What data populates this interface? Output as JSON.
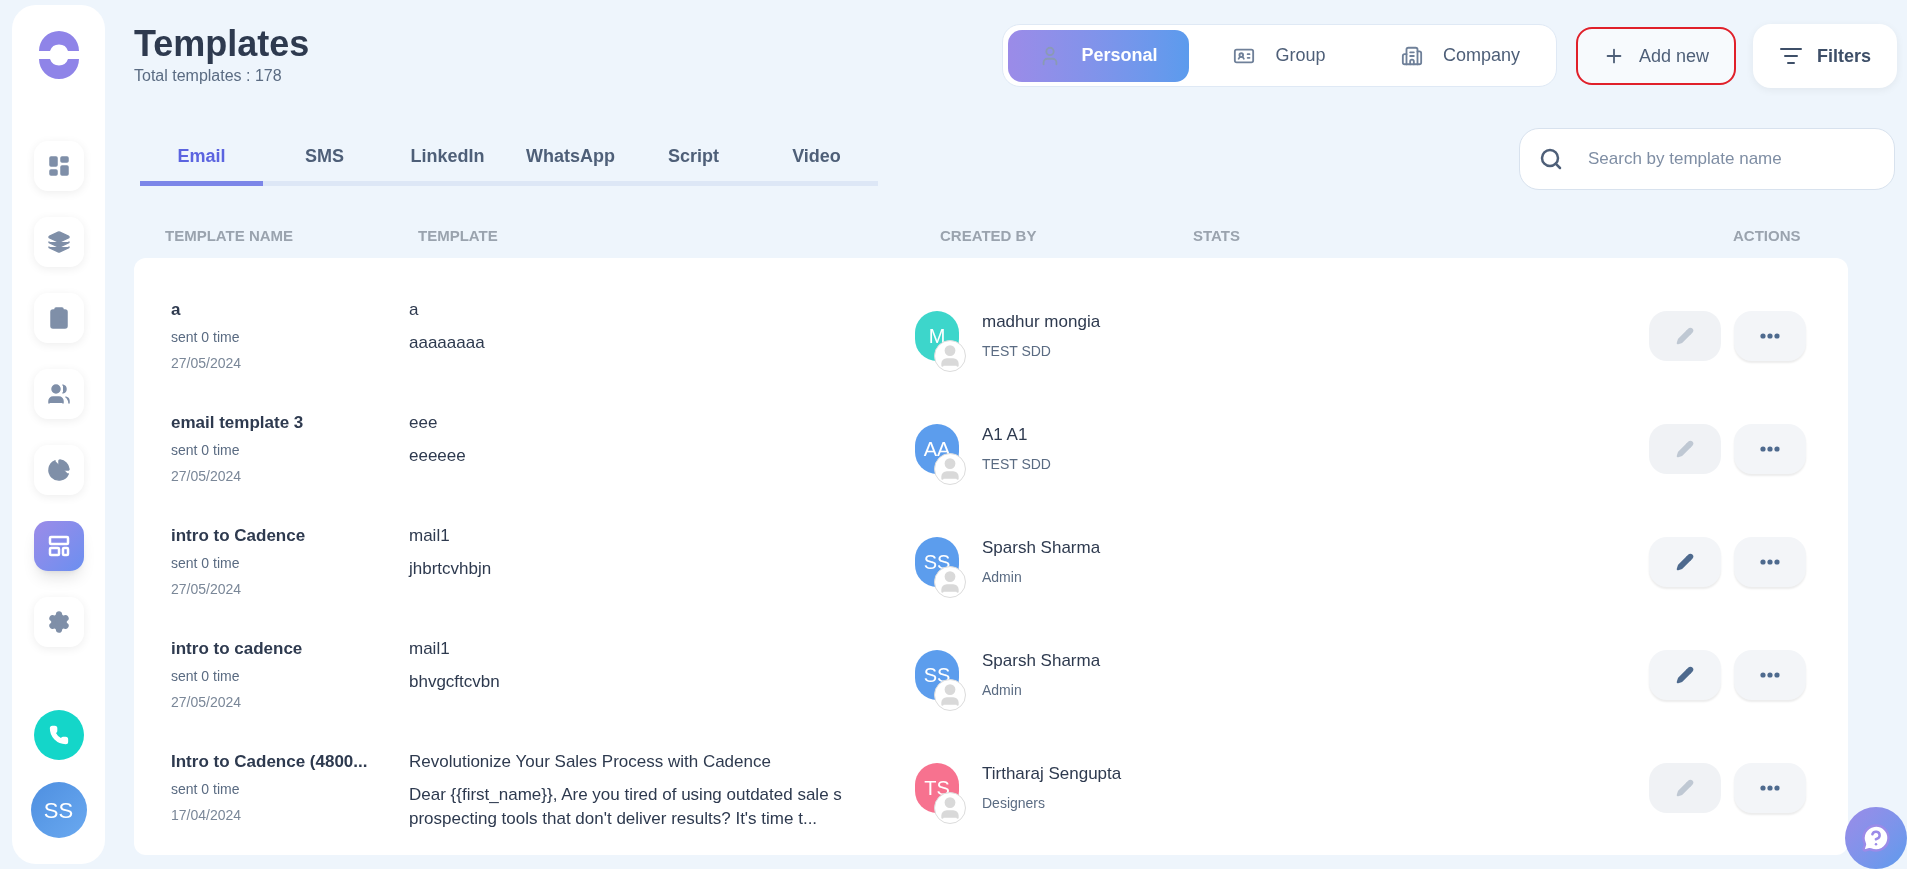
{
  "page": {
    "title": "Templates",
    "subtitle": "Total templates : 178"
  },
  "sidebar": {
    "items": [
      {
        "kind": "dashboard",
        "selected": false
      },
      {
        "kind": "stack",
        "selected": false
      },
      {
        "kind": "clipboard",
        "selected": false
      },
      {
        "kind": "people",
        "selected": false
      },
      {
        "kind": "pie",
        "selected": false
      },
      {
        "kind": "layout",
        "selected": true
      },
      {
        "kind": "settings",
        "selected": false
      }
    ],
    "user_initials": "SS"
  },
  "scope_tabs": [
    {
      "label": "Personal",
      "kind": "person",
      "selected": true
    },
    {
      "label": "Group",
      "kind": "badge",
      "selected": false
    },
    {
      "label": "Company",
      "kind": "building",
      "selected": false
    }
  ],
  "add_button": "Add new",
  "filters_button": "Filters",
  "tabs": [
    {
      "label": "Email",
      "selected": true
    },
    {
      "label": "SMS",
      "selected": false
    },
    {
      "label": "LinkedIn",
      "selected": false
    },
    {
      "label": "WhatsApp",
      "selected": false
    },
    {
      "label": "Script",
      "selected": false
    },
    {
      "label": "Video",
      "selected": false
    }
  ],
  "search": {
    "placeholder": "Search by template name"
  },
  "table": {
    "columns": [
      "TEMPLATE NAME",
      "TEMPLATE",
      "CREATED BY",
      "STATS",
      "ACTIONS"
    ],
    "rows": [
      {
        "name": "a",
        "sent": "sent 0 time",
        "date": "27/05/2024",
        "subject": "a",
        "body": "aaaaaaaa",
        "initials": "M",
        "color": "#3dd6cb",
        "author": "madhur mongia",
        "team": "TEST SDD",
        "edit_disabled": true
      },
      {
        "name": "email template 3",
        "sent": "sent 0 time",
        "date": "27/05/2024",
        "subject": "eee",
        "body": "eeeeee",
        "initials": "AA",
        "color": "#5c9ded",
        "author": "A1 A1",
        "team": "TEST SDD",
        "edit_disabled": true
      },
      {
        "name": "intro to Cadence",
        "sent": "sent 0 time",
        "date": "27/05/2024",
        "subject": "mail1",
        "body": "jhbrtcvhbjn",
        "initials": "SS",
        "color": "#5c9ded",
        "author": "Sparsh Sharma",
        "team": "Admin",
        "edit_disabled": false
      },
      {
        "name": "intro to cadence",
        "sent": "sent 0 time",
        "date": "27/05/2024",
        "subject": "mail1",
        "body": "bhvgcftcvbn",
        "initials": "SS",
        "color": "#5c9ded",
        "author": "Sparsh Sharma",
        "team": "Admin",
        "edit_disabled": false
      },
      {
        "name": "Intro to Cadence (4800...",
        "sent": "sent 0 time",
        "date": "17/04/2024",
        "subject": "Revolutionize Your Sales Process with Cadence",
        "body": "Dear {{first_name}},   Are you tired of using outdated sale s prospecting tools that don't deliver results? It's time t...",
        "initials": "TS",
        "color": "#f7728f",
        "author": "Tirtharaj Sengupta",
        "team": "Designers",
        "edit_disabled": true
      }
    ]
  }
}
